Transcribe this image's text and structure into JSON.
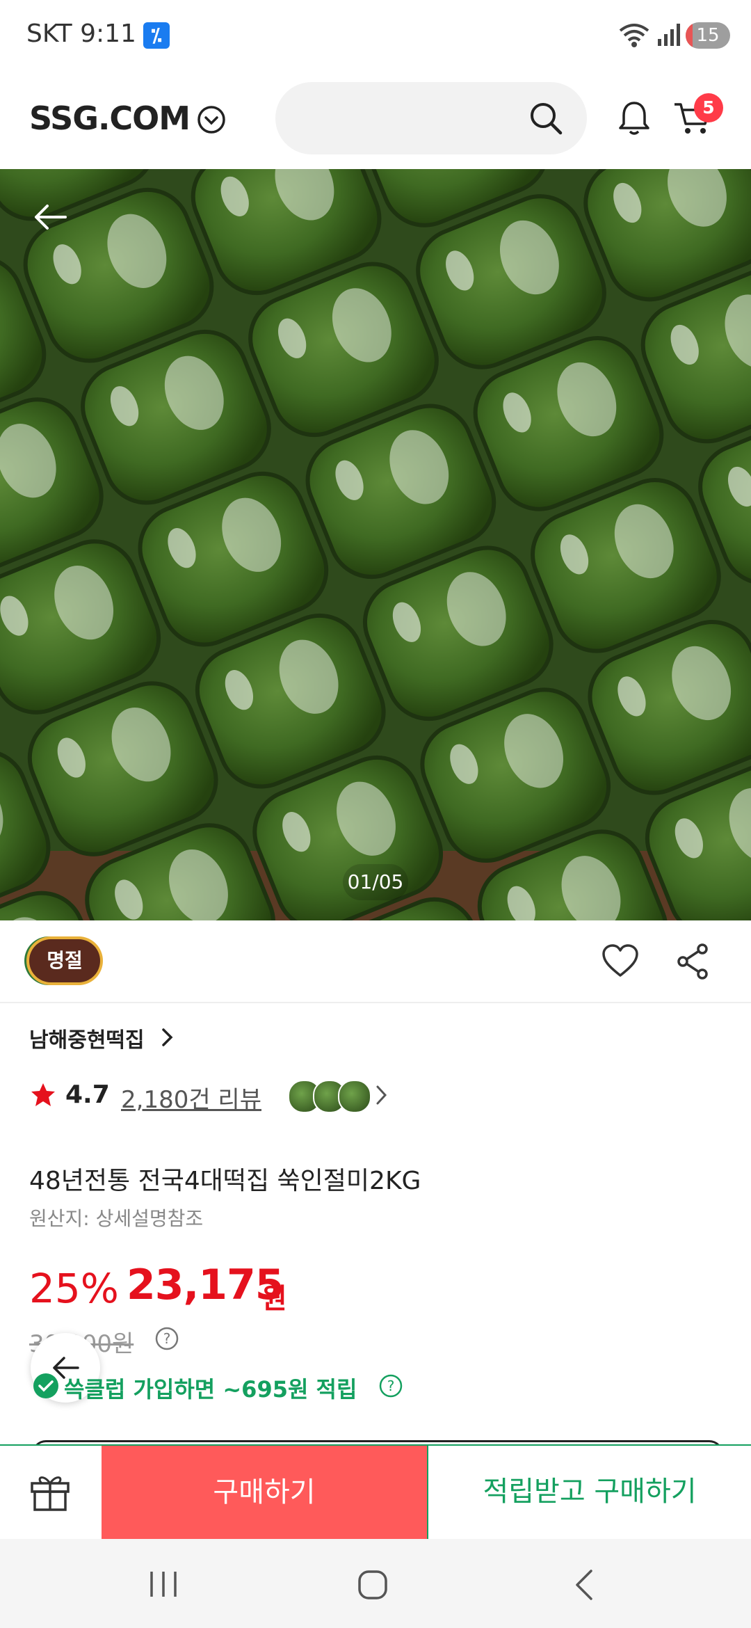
{
  "status_bar": {
    "carrier_time": "SKT 9:11",
    "app_icon_glyph": "⁒",
    "battery": "15",
    "battery_fraction": 0.15
  },
  "header": {
    "brand": "SSG.COM",
    "search": {
      "placeholder": ""
    },
    "cart_count": "5"
  },
  "gallery": {
    "counter": "01/05",
    "current_index": 1,
    "total": 5
  },
  "product": {
    "badge": "명절",
    "store": "남해중현떡집",
    "rating": "4.7",
    "review_link": "2,180건 리뷰",
    "title": "48년전통 전국4대떡집 쑥인절미2KG",
    "origin": "원산지: 상세설명참조",
    "discount": "25%",
    "price": "23,175",
    "price_unit": "원",
    "original_price": "30,900원",
    "reward_text": "쓱클럽 가입하면 ~695원 적립"
  },
  "actions": {
    "buy": "구매하기",
    "buy_with_reward": "적립받고 구매하기"
  },
  "colors": {
    "accent_red": "#e5111d",
    "buy_button": "#ff5a5a",
    "reward_green": "#14a05f",
    "badge_brown": "#5a2a1e"
  },
  "icons": [
    "search-icon",
    "bell-icon",
    "cart-icon",
    "back-arrow-icon",
    "heart-icon",
    "share-icon",
    "star-icon",
    "chevron-right-icon",
    "help-icon",
    "gift-icon",
    "nav-recents-icon",
    "nav-home-icon",
    "nav-back-icon",
    "wifi-icon",
    "signal-icon"
  ]
}
